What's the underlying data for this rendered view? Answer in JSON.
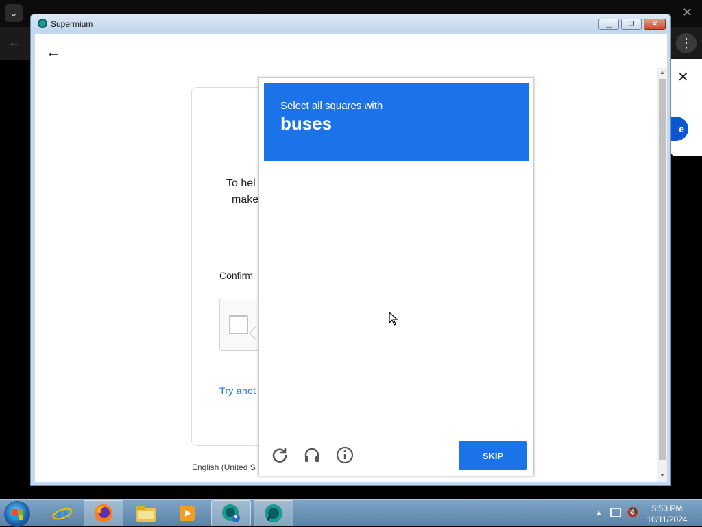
{
  "window": {
    "title": "Supermium",
    "min_glyph": "▁",
    "max_glyph": "❐",
    "close_glyph": "✕"
  },
  "page": {
    "card_line1": "To hel",
    "card_line2": "make",
    "confirm_text": "Confirm",
    "try_another": "Try anot",
    "footer_language": "English (United S"
  },
  "captcha": {
    "instruction": "Select all squares with",
    "target": "buses",
    "skip_label": "SKIP",
    "icons": [
      "reload-icon",
      "headphones-icon",
      "info-icon"
    ],
    "accent_color": "#1a73e8"
  },
  "background": {
    "panel_button_label": "e"
  },
  "taskbar": {
    "time": "5:53 PM",
    "date": "10/11/2024",
    "items": [
      "internet-explorer",
      "firefox",
      "file-explorer",
      "media-player",
      "supermium",
      "supermium"
    ]
  }
}
